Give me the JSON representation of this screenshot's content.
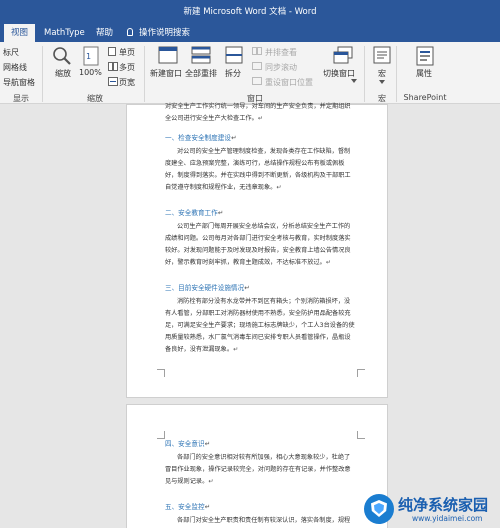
{
  "titlebar": {
    "title": "新建 Microsoft Word 文档 - Word"
  },
  "tabs": [
    {
      "label": "视图",
      "active": true
    },
    {
      "label": "MathType",
      "active": false
    },
    {
      "label": "帮助",
      "active": false
    },
    {
      "label": "操作说明搜索",
      "active": false
    }
  ],
  "ribbon": {
    "show": {
      "ruler": "标尺",
      "gridlines": "网格线",
      "nav_pane": "导航窗格",
      "group": "显示"
    },
    "zoom": {
      "zoom": "缩放",
      "percent": "100%",
      "one_page": "单页",
      "multi_page": "多页",
      "page_width": "页宽",
      "group": "缩放"
    },
    "window": {
      "new_window": "新建窗口",
      "arrange_all": "全部重排",
      "split": "拆分",
      "side_by_side": "并排查看",
      "sync_scroll": "同步滚动",
      "reset_position": "重设窗口位置",
      "switch_windows": "切换窗口",
      "group": "窗口"
    },
    "macros": {
      "label": "宏",
      "group": "宏"
    },
    "sharepoint": {
      "label": "属性",
      "group": "SharePoint"
    }
  },
  "document": {
    "page1": {
      "top_line1": "对安全生产工作实行统一领导，对车间的生产安全负责，并定期组织",
      "top_line2": "全公司进行安全生产大检查工作。",
      "sections": [
        {
          "heading": "一、检查安全制度建设",
          "body": "对公司的安全生产管理制度检查，发现各类存在工作缺陷，督制度建全、应急预案完整，演练可行，总结操作规程公布有板或佩板好，制度得到落实。并在实践中得到不断更新，各级机构及干部职工自觉遵守制度和规程作业，无违章现象。"
        },
        {
          "heading": "二、安全教育工作",
          "body": "公司生产部门每周开展安全总结会议，分析总结安全生产工作的成绩和问题。公司每月对各部门进行安全考核与教育，实时制度落实较好。对发现问题能于及时发现及时报告，安全教育上墙公告情况良好，警示教育时刻牢抓，教育主题成效，不达标准不放过。"
        },
        {
          "heading": "三、目前安全硬件设施情况",
          "body": "消防栓有部分没有水龙带并不到区有箱头；个别消防箱损坏，没有人看管，分部职工对消防器材使用不熟悉，安全防护用品配备较充足，可满足安全生产要求；现场施工标志牌缺少，个工人3台设备的使用质量较熟悉，水厂氯气消毒车间已安排专职人员看管操作，晶瓶设备良好，没有泄漏现象。"
        }
      ]
    },
    "page2": {
      "sections": [
        {
          "heading": "四、安全意识",
          "body": "各部门的安全意识相对较有所加强，相心大意现象较少，杜绝了冒目作业现象，操作记录较完全，对问题的存在有记录，并作整改意见与规则记录。"
        },
        {
          "heading": "五、安全监控",
          "body": "各部门对安全生产职责和责任制有较深认识，落实各制度，规程的自"
        }
      ]
    },
    "para_mark": "↵"
  },
  "watermark": {
    "brand": "纯净系统家园",
    "url": "www.yidaimei.com"
  }
}
